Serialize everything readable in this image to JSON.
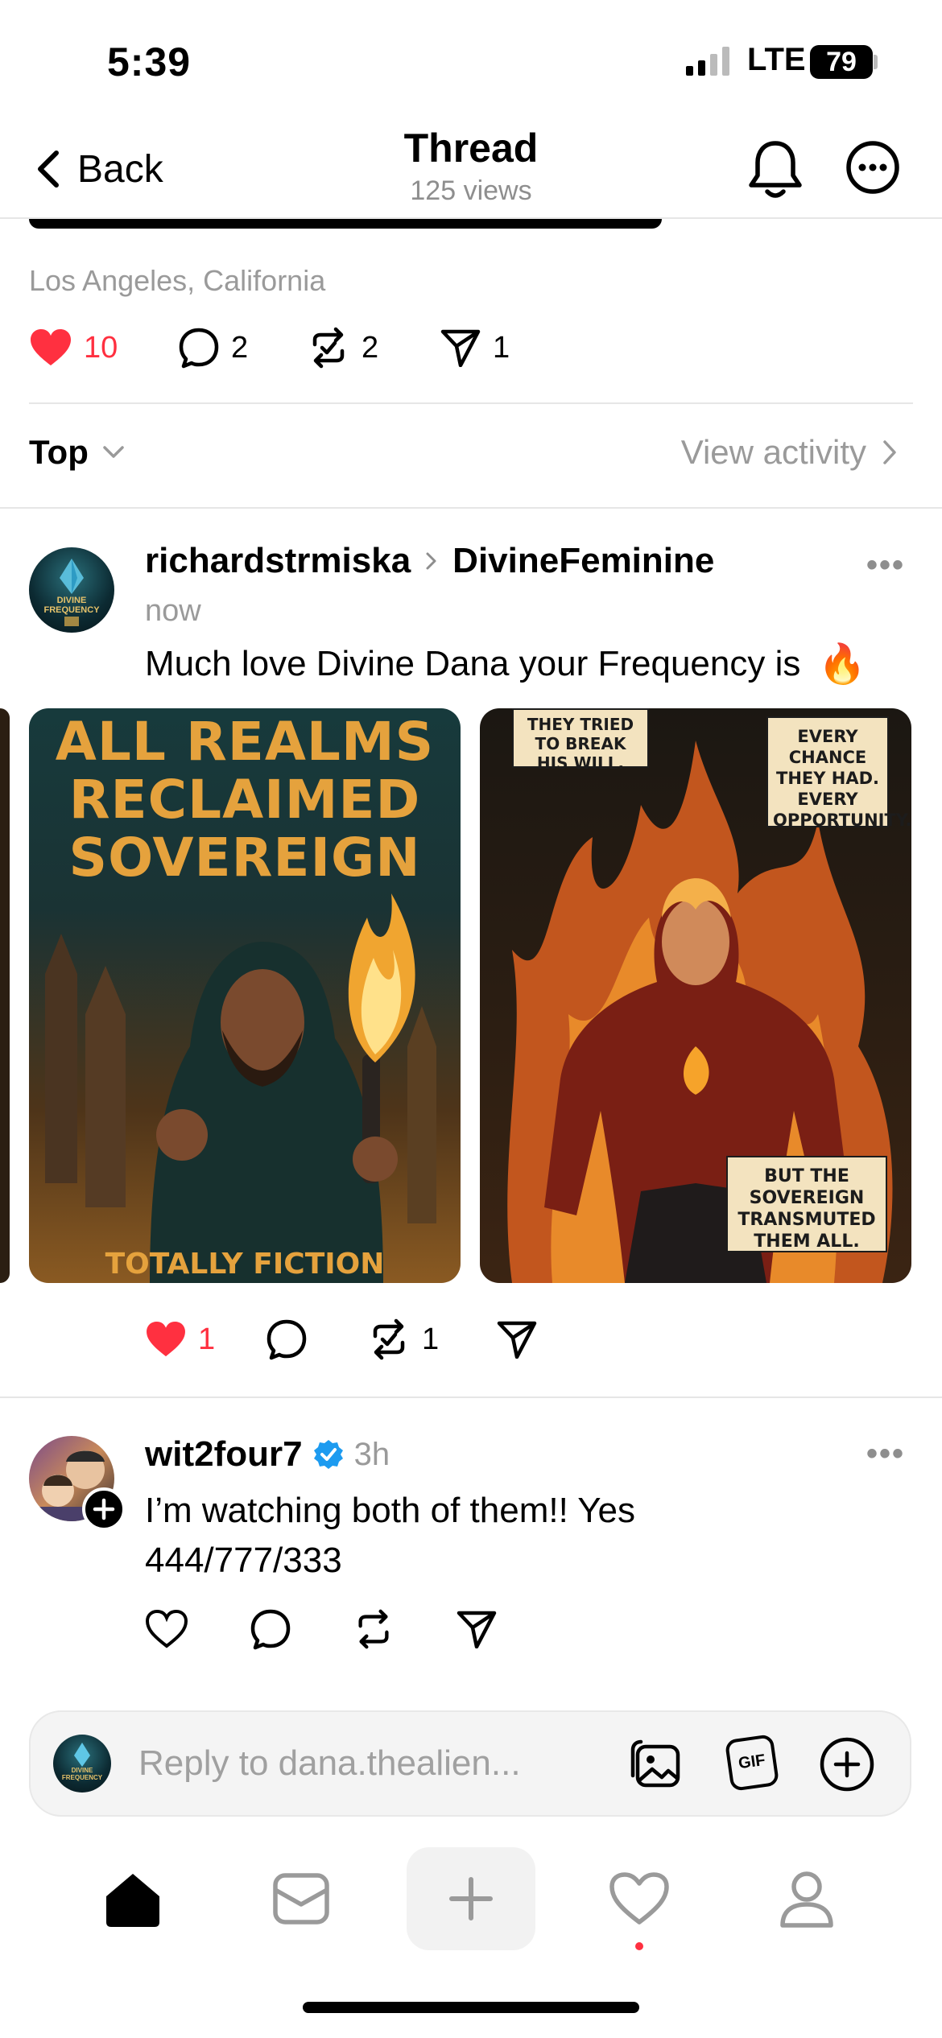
{
  "status": {
    "time": "5:39",
    "network": "LTE",
    "battery": "79"
  },
  "nav": {
    "back_label": "Back",
    "title": "Thread",
    "views": "125 views"
  },
  "post": {
    "location": "Los Angeles, California",
    "likes": "10",
    "comments": "2",
    "reposts": "2",
    "shares": "1"
  },
  "sort": {
    "label": "Top",
    "activity_label": "View activity"
  },
  "reply1": {
    "username": "richardstrmiska",
    "community": "DivineFeminine",
    "time": "now",
    "text": "Much love Divine Dana your Frequency is",
    "emoji": "🔥",
    "avatar_text": "DIVINE FREQUENCY",
    "image1": {
      "headline_lines": [
        "ALL REALMS",
        "RECLAIMED",
        "SOVEREIGN"
      ],
      "footer": "TOTALLY FICTION"
    },
    "image2": {
      "caption_top_left": "THEY TRIED TO BREAK HIS WILL.",
      "caption_top_right": "EVERY CHANCE THEY HAD. EVERY OPPORTUNITY.",
      "caption_bottom": "BUT THE SOVEREIGN TRANSMUTED THEM ALL."
    },
    "likes": "1",
    "reposts": "1"
  },
  "reply2": {
    "username": "wit2four7",
    "time": "3h",
    "text_line1": "I’m watching both of them!! Yes",
    "text_line2": "444/777/333"
  },
  "composer": {
    "placeholder": "Reply to dana.thealien...",
    "gif_label": "GIF",
    "avatar_text": "DIVINE FREQUENCY"
  },
  "colors": {
    "like_red": "#ff3040",
    "verified_blue": "#1d9bf0",
    "grey_text": "#9a9a9a"
  }
}
